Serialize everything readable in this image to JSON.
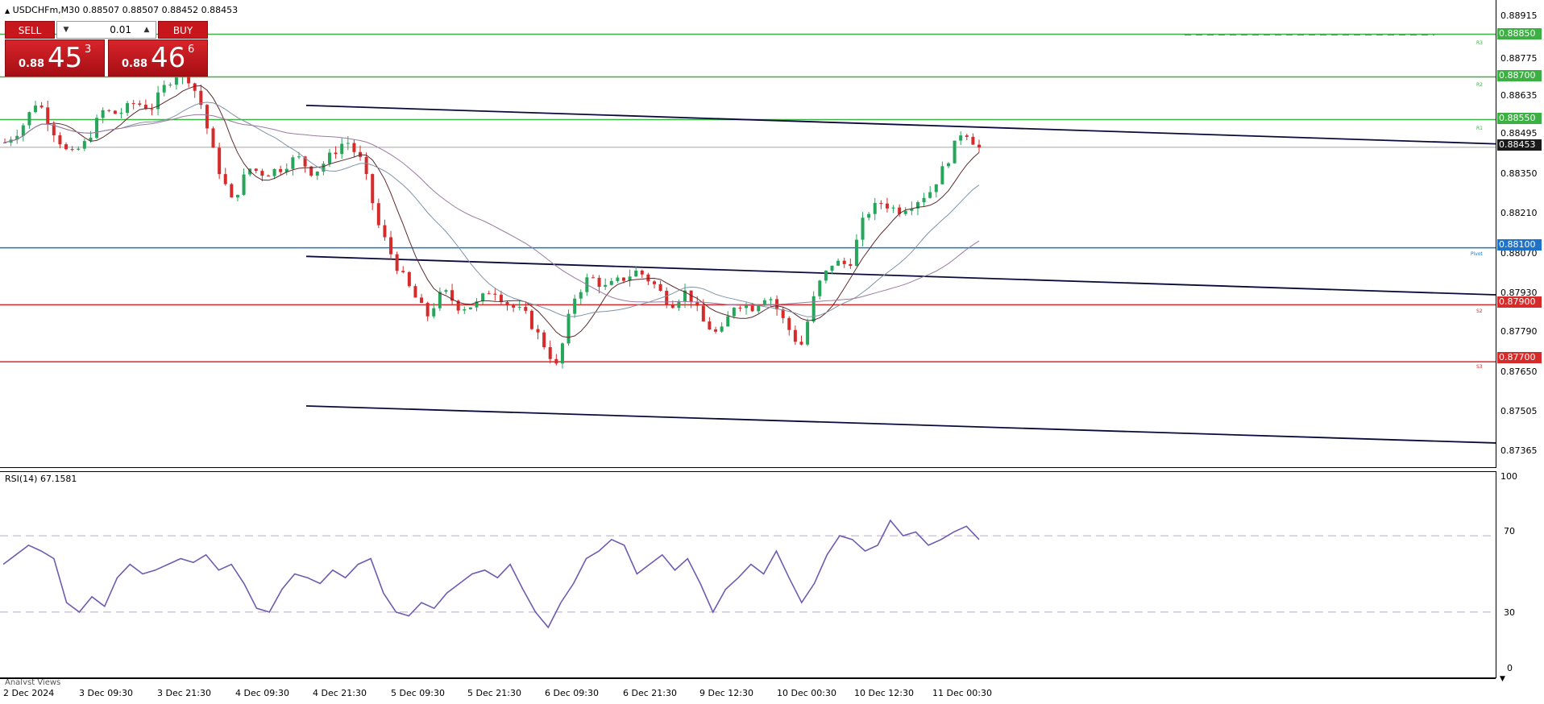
{
  "symbol_header": "USDCHFm,M30  0.88507 0.88507 0.88452 0.88453",
  "trade_panel": {
    "sell_label": "SELL",
    "buy_label": "BUY",
    "lot": "0.01",
    "sell_price_small": "0.88",
    "sell_price_big": "45",
    "sell_price_sup": "3",
    "buy_price_small": "0.88",
    "buy_price_big": "46",
    "buy_price_sup": "6"
  },
  "price_axis": [
    "0.88915",
    "0.88775",
    "0.88635",
    "0.88495",
    "0.88350",
    "0.88210",
    "0.88070",
    "0.87930",
    "0.87790",
    "0.87650",
    "0.87505",
    "0.87365"
  ],
  "level_tags": [
    {
      "label": "0.88850",
      "color": "#3cb043",
      "price": 0.8885
    },
    {
      "label": "0.88700",
      "color": "#3cb043",
      "price": 0.887
    },
    {
      "label": "0.88550",
      "color": "#3cb043",
      "price": 0.8855
    },
    {
      "label": "0.88453",
      "color": "#1a1a1a",
      "price": 0.88453
    },
    {
      "label": "0.88100",
      "color": "#1e73c8",
      "price": 0.881
    },
    {
      "label": "0.87900",
      "color": "#d62b2b",
      "price": 0.879
    },
    {
      "label": "0.87700",
      "color": "#d62b2b",
      "price": 0.877
    }
  ],
  "level_names": [
    "R3",
    "R2",
    "R1",
    "Pivot",
    "S2",
    "S3"
  ],
  "rsi_header": "RSI(14) 67.1581",
  "rsi_axis": [
    "100",
    "70",
    "30",
    "0"
  ],
  "dates": [
    "2 Dec 2024",
    "3 Dec 09:30",
    "3 Dec 21:30",
    "4 Dec 09:30",
    "4 Dec 21:30",
    "5 Dec 09:30",
    "5 Dec 21:30",
    "6 Dec 09:30",
    "6 Dec 21:30",
    "9 Dec 12:30",
    "10 Dec 00:30",
    "10 Dec 12:30",
    "11 Dec 00:30"
  ],
  "analyst_views_label": "Analyst Views",
  "colors": {
    "bull": "#26a65b",
    "bear": "#d62b2b",
    "rsi": "#6f5bb0",
    "ma1": "#5d2b2b",
    "ma2": "#7d93a6",
    "ma3": "#9b7aa0",
    "trend": "#0a0a3a"
  },
  "chart_data": {
    "type": "candlestick",
    "timeframe": "M30",
    "current_price": 0.88453,
    "ohlc_header": {
      "open": 0.88507,
      "high": 0.88507,
      "low": 0.88452,
      "close": 0.88453
    },
    "resistance_levels": {
      "R3": 0.8885,
      "R2": 0.887,
      "R1": 0.8855
    },
    "pivot": 0.881,
    "support_levels": {
      "S2": 0.879,
      "S3": 0.877
    },
    "ylim": [
      0.8733,
      0.8897
    ],
    "close_path": [
      0.8847,
      0.8852,
      0.8862,
      0.8851,
      0.8842,
      0.8847,
      0.8858,
      0.8857,
      0.8861,
      0.8859,
      0.8868,
      0.8873,
      0.8862,
      0.884,
      0.8826,
      0.8838,
      0.8836,
      0.8838,
      0.8842,
      0.8836,
      0.8842,
      0.8848,
      0.884,
      0.8818,
      0.8805,
      0.8795,
      0.8786,
      0.8795,
      0.8789,
      0.879,
      0.8796,
      0.879,
      0.8787,
      0.8778,
      0.8768,
      0.8792,
      0.88,
      0.8796,
      0.8799,
      0.8802,
      0.8797,
      0.879,
      0.8795,
      0.8784,
      0.8779,
      0.8791,
      0.8789,
      0.8794,
      0.8784,
      0.8775,
      0.8796,
      0.8805,
      0.8804,
      0.8822,
      0.8826,
      0.8823,
      0.8826,
      0.883,
      0.884,
      0.8852,
      0.8845
    ],
    "rsi": {
      "period": 14,
      "value": 67.1581,
      "levels": [
        70,
        30
      ],
      "ylim": [
        0,
        100
      ],
      "values": [
        55,
        60,
        65,
        62,
        58,
        35,
        30,
        38,
        33,
        48,
        55,
        50,
        52,
        55,
        58,
        56,
        60,
        52,
        55,
        45,
        32,
        30,
        42,
        50,
        48,
        45,
        52,
        48,
        55,
        58,
        40,
        30,
        28,
        35,
        32,
        40,
        45,
        50,
        52,
        48,
        55,
        42,
        30,
        22,
        35,
        45,
        58,
        62,
        68,
        65,
        50,
        55,
        60,
        52,
        58,
        45,
        30,
        42,
        48,
        55,
        50,
        62,
        48,
        35,
        45,
        60,
        70,
        68,
        62,
        65,
        78,
        70,
        72,
        65,
        68,
        72,
        75,
        68
      ]
    }
  }
}
